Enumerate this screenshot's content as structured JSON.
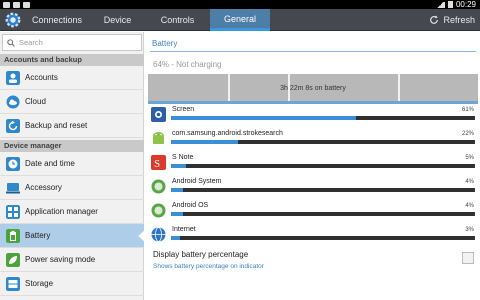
{
  "status_bar": {
    "time": "00:29"
  },
  "action_bar": {
    "tabs": [
      {
        "label": "Connections",
        "active": false
      },
      {
        "label": "Device",
        "active": false
      },
      {
        "label": "Controls",
        "active": false
      },
      {
        "label": "General",
        "active": true
      }
    ],
    "refresh_label": "Refresh",
    "app_icon": "settings-gear-icon"
  },
  "sidebar": {
    "search_placeholder": "Search",
    "sections": [
      {
        "header": "Accounts and backup",
        "items": [
          {
            "label": "Accounts",
            "icon": "accounts-icon"
          },
          {
            "label": "Cloud",
            "icon": "cloud-icon"
          },
          {
            "label": "Backup and reset",
            "icon": "backup-icon"
          }
        ]
      },
      {
        "header": "Device manager",
        "items": [
          {
            "label": "Date and time",
            "icon": "clock-icon"
          },
          {
            "label": "Accessory",
            "icon": "accessory-icon"
          },
          {
            "label": "Application manager",
            "icon": "app-manager-icon"
          },
          {
            "label": "Battery",
            "icon": "battery-icon",
            "active": true
          },
          {
            "label": "Power saving mode",
            "icon": "power-saving-icon"
          },
          {
            "label": "Storage",
            "icon": "storage-icon"
          }
        ]
      }
    ]
  },
  "main": {
    "title": "Battery",
    "status": "64% - Not charging",
    "graph_label": "3h 22m 8s on battery",
    "apps": [
      {
        "name": "Screen",
        "percent": "61%",
        "value": 61,
        "icon": "screen-icon"
      },
      {
        "name": "com.samsung.android.strokesearch",
        "percent": "22%",
        "value": 22,
        "icon": "android-icon"
      },
      {
        "name": "S Note",
        "percent": "5%",
        "value": 5,
        "icon": "s-note-icon"
      },
      {
        "name": "Android System",
        "percent": "4%",
        "value": 4,
        "icon": "android-system-icon"
      },
      {
        "name": "Android OS",
        "percent": "4%",
        "value": 4,
        "icon": "android-os-icon"
      },
      {
        "name": "Internet",
        "percent": "3%",
        "value": 3,
        "icon": "globe-icon"
      }
    ],
    "display_percentage": {
      "title": "Display battery percentage",
      "subtitle": "Shows battery percentage on indicator",
      "checked": false
    }
  },
  "colors": {
    "accent": "#3a8fd6",
    "active_tab": "#4d7ea7",
    "action_bar": "#45494f"
  }
}
